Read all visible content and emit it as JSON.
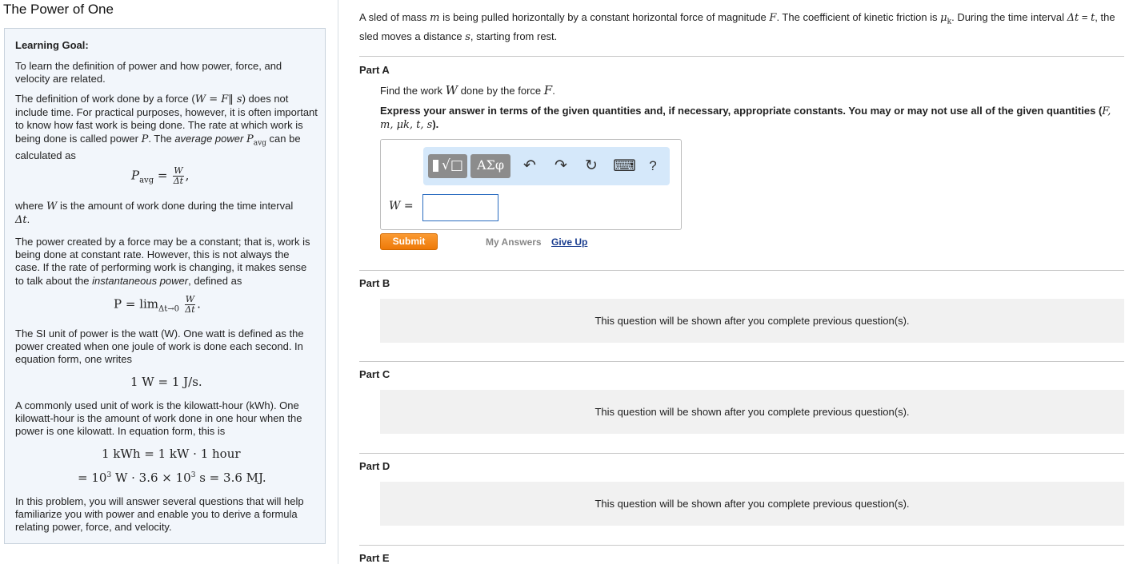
{
  "title": "The Power of One",
  "goal": {
    "heading": "Learning Goal:",
    "p1": "To learn the definition of power and how power, force, and velocity are related.",
    "p2_a": "The definition of work done by a force (",
    "p2_formula": "W = F‖ s",
    "p2_b": ") does not include time. For practical purposes, however, it is often important to know how fast work is being done. The rate at which work is being done is called power ",
    "p2_P": "P",
    "p2_c": ". The ",
    "p2_avg": "average power",
    "p2_d": " ",
    "p2_Pavg": "P",
    "p2_sub": "avg",
    "p2_e": " can be calculated as",
    "eq1_lhs": "P",
    "eq1_sub": "avg",
    "eq1_eq": "=",
    "eq1_num": "W",
    "eq1_den": "Δt",
    "eq1_tail": ",",
    "p3_a": "where ",
    "p3_W": "W",
    "p3_b": " is the amount of work done during the time interval ",
    "p3_dt": "Δt",
    "p3_c": ".",
    "p4_a": "The power created by a force may be a constant; that is, work is being done at constant rate. However, this is not always the case. If the rate of performing work is changing, it makes sense to talk about the ",
    "p4_inst": "instantaneous power",
    "p4_b": ", defined as",
    "eq2_lhs": "P = lim",
    "eq2_sub": "Δt→0",
    "eq2_num": "W",
    "eq2_den": "Δt",
    "eq2_tail": ".",
    "p5": "The SI unit of power is the watt (W). One watt is defined as the power created when one joule of work is done each second. In equation form, one writes",
    "eq3": "1 W = 1 J/s.",
    "p6": "A commonly used unit of work is the kilowatt-hour (kWh). One kilowatt-hour is the amount of work done in one hour when the power is one kilowatt. In equation form, this is",
    "eq4": "1 kWh = 1 kW · 1 hour",
    "eq5_a": "= 10",
    "eq5_exp1": "3",
    "eq5_b": " W · 3.6 × 10",
    "eq5_exp2": "3",
    "eq5_c": " s = 3.6 MJ.",
    "p7": "In this problem, you will answer several questions that will help familiarize you with power and enable you to derive a formula relating power, force, and velocity."
  },
  "problem": {
    "a": "A sled of mass ",
    "m": "m",
    "b": " is being pulled horizontally by a constant horizontal force of magnitude ",
    "F": "F",
    "c": ". The coefficient of kinetic friction is ",
    "mu": "μ",
    "mu_sub": "k",
    "d": ". During the time interval ",
    "dt": "Δt",
    "e": " = ",
    "t": "t",
    "f": ", the sled moves a distance ",
    "s": "s",
    "g": ", starting from rest."
  },
  "partA": {
    "label": "Part A",
    "q_a": "Find the work ",
    "q_W": "W",
    "q_b": " done by the force ",
    "q_F": "F",
    "q_c": ".",
    "instr_a": "Express your answer in terms of the given quantities and, if necessary, appropriate constants. You may or may not use all of the given quantities (",
    "instr_vars": "F, m, μk, t, s",
    "instr_b": ").",
    "answer_label": "W =",
    "answer_value": "",
    "toolbar": {
      "templates_label": "√□",
      "greek_label": "ΑΣφ",
      "undo": "↶",
      "redo": "↷",
      "reset": "↻",
      "keyboard": "⌨",
      "help": "?"
    },
    "submit": "Submit",
    "my_answers": "My Answers",
    "give_up": "Give Up"
  },
  "parts": [
    {
      "label": "Part B",
      "locked_msg": "This question will be shown after you complete previous question(s)."
    },
    {
      "label": "Part C",
      "locked_msg": "This question will be shown after you complete previous question(s)."
    },
    {
      "label": "Part D",
      "locked_msg": "This question will be shown after you complete previous question(s)."
    },
    {
      "label": "Part E"
    }
  ]
}
